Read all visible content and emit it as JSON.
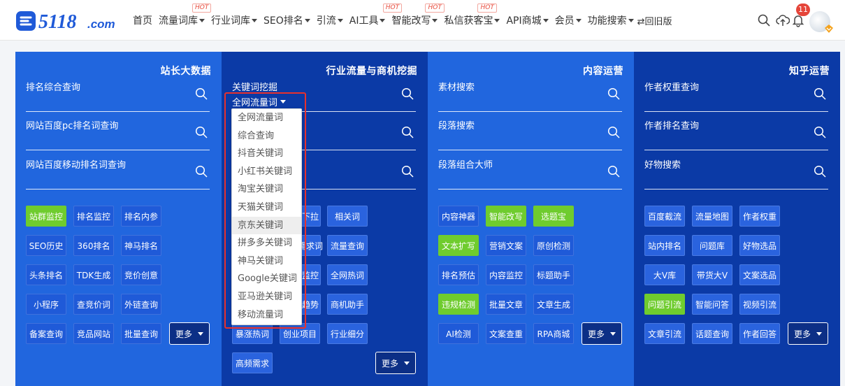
{
  "logo": {
    "text": "5118",
    "suffix": ".com"
  },
  "nav": [
    {
      "label": "首页",
      "caret": false,
      "hot": false
    },
    {
      "label": "流量词库",
      "caret": true,
      "hot": true
    },
    {
      "label": "行业词库",
      "caret": true,
      "hot": false
    },
    {
      "label": "SEO排名",
      "caret": true,
      "hot": false
    },
    {
      "label": "引流",
      "caret": true,
      "hot": false
    },
    {
      "label": "AI工具",
      "caret": true,
      "hot": true
    },
    {
      "label": "智能改写",
      "caret": true,
      "hot": true
    },
    {
      "label": "私信获客宝",
      "caret": true,
      "hot": true
    },
    {
      "label": "API商城",
      "caret": true,
      "hot": false
    },
    {
      "label": "会员",
      "caret": true,
      "hot": false
    },
    {
      "label": "功能搜索",
      "caret": true,
      "hot": false
    }
  ],
  "hot_label": "HOT",
  "old_version": "⇄回旧版",
  "notification_count": "11",
  "columns": [
    {
      "title": "站长大数据",
      "fields": [
        {
          "label": "排名综合查询"
        },
        {
          "label": "网站百度pc排名词查询"
        },
        {
          "label": "网站百度移动排名词查询"
        }
      ],
      "buttons": [
        [
          "站群监控",
          "排名监控",
          "排名内参"
        ],
        [
          "SEO历史",
          "360排名",
          "神马排名"
        ],
        [
          "头条排名",
          "TDK生成",
          "竞价创意"
        ],
        [
          "小程序",
          "查竞价词",
          "外链查询"
        ],
        [
          "备案查询",
          "竞品网站",
          "批量查询"
        ]
      ],
      "green": [
        "站群监控"
      ],
      "more": "更多"
    },
    {
      "title": "行业流量与商机挖掘",
      "fields": [
        {
          "label": "关键词挖掘",
          "select": "全网流量词"
        },
        {
          "label": ""
        },
        {
          "label": ""
        }
      ],
      "buttons": [
        [
          "下拉",
          "相关词"
        ],
        [
          "需求词",
          "流量查询"
        ],
        [
          "监控",
          "全网热词"
        ],
        [
          "趋势",
          "商机助手"
        ],
        [
          "暴涨热词",
          "创业项目",
          "行业细分"
        ],
        [
          "高频需求"
        ]
      ],
      "green": [],
      "more": "更多"
    },
    {
      "title": "内容运营",
      "fields": [
        {
          "label": "素材搜索"
        },
        {
          "label": "段落搜索"
        },
        {
          "label": "段落组合大师"
        }
      ],
      "buttons": [
        [
          "内容神器",
          "智能改写",
          "选题宝"
        ],
        [
          "文本扩写",
          "营销文案",
          "原创检测"
        ],
        [
          "排名预估",
          "内容监控",
          "标题助手"
        ],
        [
          "违规检测",
          "批量文章",
          "文章生成"
        ],
        [
          "AI检测",
          "文案查重",
          "RPA商城"
        ]
      ],
      "green": [
        "智能改写",
        "选题宝",
        "文本扩写",
        "违规检测"
      ],
      "more": "更多"
    },
    {
      "title": "知乎运营",
      "fields": [
        {
          "label": "作者权重查询"
        },
        {
          "label": "作者排名查询"
        },
        {
          "label": "好物搜索"
        }
      ],
      "buttons": [
        [
          "百度截流",
          "流量地图",
          "作者权重"
        ],
        [
          "站内排名",
          "问题库",
          "好物选品"
        ],
        [
          "大V库",
          "带货大V",
          "文案选品"
        ],
        [
          "问题引流",
          "智能问答",
          "视频引流"
        ],
        [
          "文章引流",
          "话题查询",
          "作者回答"
        ]
      ],
      "green": [
        "问题引流"
      ],
      "more": "更多"
    }
  ],
  "dropdown": {
    "items": [
      "全网流量词",
      "综合查询",
      "抖音关键词",
      "小红书关键词",
      "淘宝关键词",
      "天猫关键词",
      "京东关键词",
      "拼多多关键词",
      "神马关键词",
      "Google关键词",
      "亚马逊关键词",
      "移动流量词"
    ],
    "active": "京东关键词"
  },
  "colors": {
    "blue_light": "#2166de",
    "blue_dark": "#0b3aa6",
    "green": "#6fcc2e",
    "highlight": "#e8312c",
    "logo": "#1f5ad8"
  },
  "icons": [
    "search-icon",
    "cloud-upload-icon",
    "bell-icon",
    "vip-diamond-icon",
    "caret-down-icon"
  ]
}
